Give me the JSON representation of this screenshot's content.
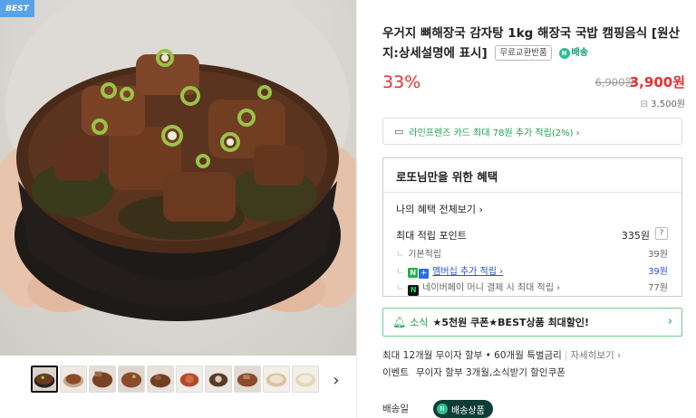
{
  "gallery": {
    "badge": "BEST",
    "thumb_count": 10,
    "next_glyph": "›"
  },
  "product": {
    "title": "우거지 뼈해장국 감자탕 1kg 해장국 국밥 캠핑음식 [원산지:상세설명에 표시]",
    "exchange_tag": "무료교환반품",
    "delivery_tag": "배송",
    "discount_rate": "33%",
    "original_price": "6,900원",
    "sale_price": "3,900원",
    "point_price": "3,500원"
  },
  "card_benefit": {
    "text": "라인프렌즈 카드 최대 78원 추가 적립(2%) ›"
  },
  "benefits": {
    "header": "로또님만을 위한 혜택",
    "view_all": "나의 혜택 전체보기 ›",
    "max_points_label": "최대 적립 포인트",
    "max_points_value": "335원",
    "help": "?",
    "base_label": "기본적립",
    "base_value": "39원",
    "membership_label": "멤버십 추가 적립 ›",
    "membership_value": "39원",
    "pay_label": "네이버페이 머니 결제 시 최대 적립 ›",
    "pay_value": "77원"
  },
  "news": {
    "label": "소식",
    "text": "★5천원 쿠폰★BEST상품 최대할인!",
    "arrow": "›"
  },
  "installment": {
    "text": "최대 12개월 무이자 할부 • 60개월 특별금리",
    "more": "자세히보기 ›"
  },
  "event": {
    "label": "이벤트",
    "text": "무이자 할부 3개월,소식받기 할인쿠폰"
  },
  "shipping": {
    "label": "배송일",
    "badge": "배송상품"
  },
  "colors": {
    "price_red": "#e53030",
    "naver_green": "#1aa34a",
    "link_blue": "#2a4fd6",
    "ship_badge": "#0f3d36"
  }
}
